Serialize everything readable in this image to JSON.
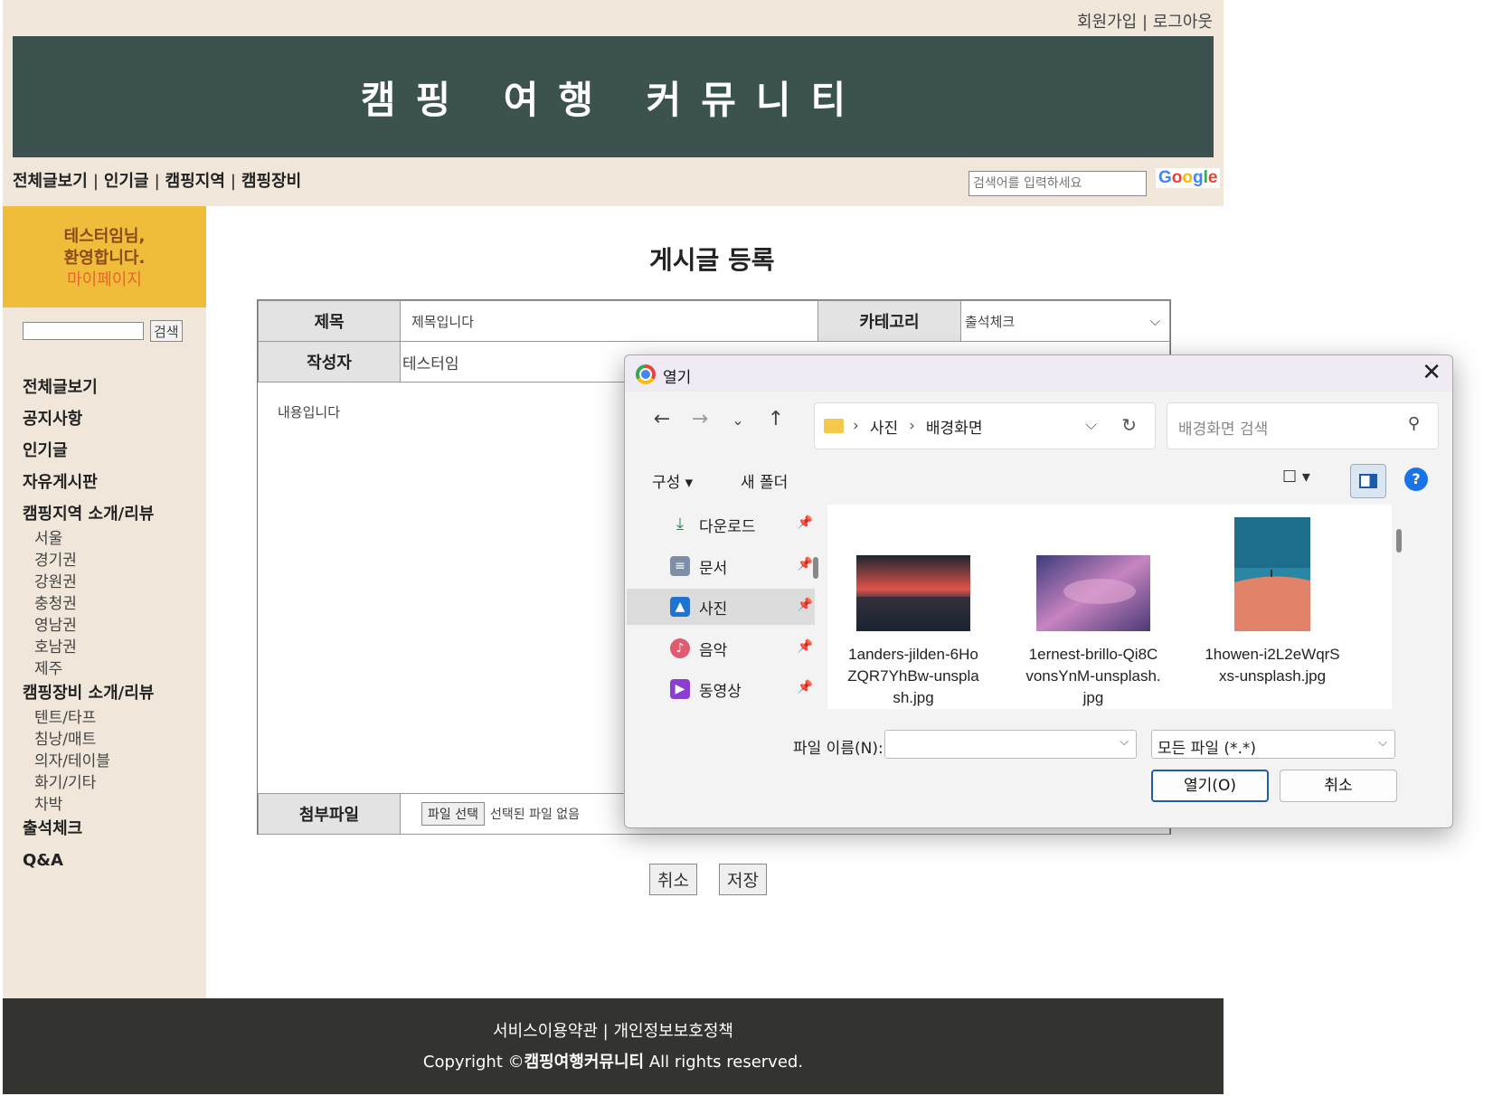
{
  "header": {
    "auth_links": {
      "signup": "회원가입",
      "separator": "|",
      "logout": "로그아웃"
    },
    "site_title": "캠핑 여행 커뮤니티",
    "nav": [
      "전체글보기",
      "인기글",
      "캠핑지역",
      "캠핑장비"
    ],
    "nav_separator": "|",
    "search_placeholder": "검색어를 입력하세요",
    "search_logo": "Google"
  },
  "sidebar": {
    "welcome_line1": "테스터임님,",
    "welcome_line2": "환영합니다.",
    "mypage": "마이페이지",
    "search_button": "검색",
    "menu": {
      "all_posts": "전체글보기",
      "notice": "공지사항",
      "popular": "인기글",
      "free_board": "자유게시판",
      "region": "캠핑지역 소개/리뷰",
      "region_items": [
        "서울",
        "경기권",
        "강원권",
        "충청권",
        "영남권",
        "호남권",
        "제주"
      ],
      "gear": "캠핑장비 소개/리뷰",
      "gear_items": [
        "텐트/타프",
        "침낭/매트",
        "의자/테이블",
        "화기/기타",
        "차박"
      ],
      "attendance": "출석체크",
      "qna": "Q&A"
    }
  },
  "form": {
    "page_title": "게시글 등록",
    "title_label": "제목",
    "title_value": "제목입니다",
    "category_label": "카테고리",
    "category_value": "출석체크",
    "author_label": "작성자",
    "author_value": "테스터임",
    "content_value": "내용입니다",
    "attach_label": "첨부파일",
    "file_button": "파일 선택",
    "file_status": "선택된 파일 없음",
    "cancel_button": "취소",
    "save_button": "저장"
  },
  "footer": {
    "terms": "서비스이용약관",
    "separator": "|",
    "privacy": "개인정보보호정책",
    "copyright_prefix": "Copyright ©",
    "copyright_brand": "캠핑여행커뮤니티",
    "copyright_suffix": " All rights reserved."
  },
  "dialog": {
    "title": "열기",
    "path": [
      "사진",
      "배경화면"
    ],
    "search_placeholder": "배경화면 검색",
    "organize": "구성 ▾",
    "new_folder": "새 폴더",
    "nav_items": [
      {
        "label": "다운로드",
        "icon": "download-icon"
      },
      {
        "label": "문서",
        "icon": "document-icon"
      },
      {
        "label": "사진",
        "icon": "pictures-icon",
        "selected": true
      },
      {
        "label": "음악",
        "icon": "music-icon"
      },
      {
        "label": "동영상",
        "icon": "video-icon"
      }
    ],
    "files": [
      {
        "name": "1anders-jilden-6HoZQR7YhBw-unsplash.jpg"
      },
      {
        "name": "1ernest-brillo-Qi8CvonsYnM-unsplash.jpg"
      },
      {
        "name": "1howen-i2L2eWqrSxs-unsplash.jpg"
      }
    ],
    "filename_label": "파일 이름(N):",
    "filename_value": "",
    "filetype_value": "모든 파일 (*.*)",
    "open_button": "열기(O)",
    "cancel_button": "취소"
  }
}
